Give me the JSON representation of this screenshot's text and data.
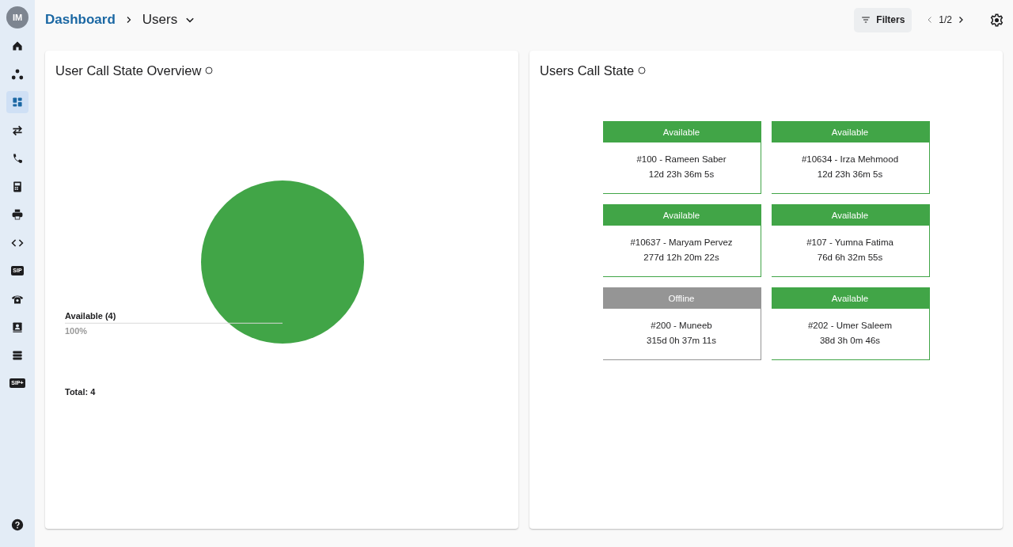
{
  "sidebar": {
    "avatar": "IM",
    "items": [
      {
        "kind": "home",
        "selected": false
      },
      {
        "kind": "nodes",
        "selected": false
      },
      {
        "kind": "dashboard",
        "selected": true
      },
      {
        "kind": "transfer",
        "selected": false
      },
      {
        "kind": "call",
        "selected": false
      },
      {
        "kind": "fax",
        "selected": false
      },
      {
        "kind": "printer",
        "selected": false
      },
      {
        "kind": "code",
        "selected": false
      },
      {
        "kind": "badge",
        "text": "SIP",
        "selected": false
      },
      {
        "kind": "phone",
        "selected": false
      },
      {
        "kind": "contact",
        "selected": false
      },
      {
        "kind": "list",
        "selected": false
      },
      {
        "kind": "badge",
        "text": "SIP+",
        "selected": false
      }
    ]
  },
  "header": {
    "breadcrumb": [
      "Dashboard",
      "Users"
    ],
    "filters": "Filters",
    "page": "1/2"
  },
  "overview": {
    "title": "User Call State Overview",
    "slice_percent": "100%",
    "total": "Total: 4",
    "chart_data": {
      "type": "pie",
      "categories": [
        "Available (4)"
      ],
      "values": [
        100
      ]
    }
  },
  "states": {
    "title": "Users Call State",
    "cards": [
      {
        "status": "Available",
        "kind": "available",
        "name": "#100 - Rameen Saber",
        "duration": "12d 23h 36m 5s"
      },
      {
        "status": "Available",
        "kind": "available",
        "name": "#10634 - Irza Mehmood",
        "duration": "12d 23h 36m 5s"
      },
      {
        "status": "Available",
        "kind": "available",
        "name": "#10637 - Maryam Pervez",
        "duration": "277d 12h 20m 22s"
      },
      {
        "status": "Available",
        "kind": "available",
        "name": "#107 - Yumna Fatima",
        "duration": "76d 6h 32m 55s"
      },
      {
        "status": "Offline",
        "kind": "offline",
        "name": "#200 - Muneeb",
        "duration": "315d 0h 37m 11s"
      },
      {
        "status": "Available",
        "kind": "available",
        "name": "#202 - Umer Saleem",
        "duration": "38d 3h 0m 46s"
      }
    ]
  }
}
